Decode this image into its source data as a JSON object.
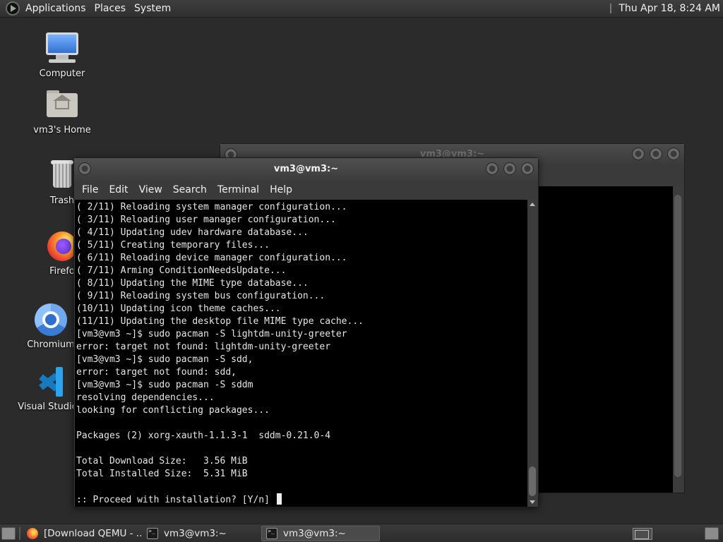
{
  "top_panel": {
    "menus": [
      "Applications",
      "Places",
      "System"
    ],
    "clock": "Thu Apr 18,  8:24 AM"
  },
  "desktop_icons": [
    {
      "label": "Computer",
      "icon": "computer-icon"
    },
    {
      "label": "vm3's Home",
      "icon": "home-folder-icon"
    },
    {
      "label": "Trash",
      "icon": "trash-icon"
    },
    {
      "label": "Firefo",
      "icon": "firefox-icon"
    },
    {
      "label": "Chromium",
      "icon": "chromium-icon"
    },
    {
      "label": "Visual Studio C",
      "icon": "vscode-icon"
    }
  ],
  "back_window": {
    "title": "vm3@vm3:~"
  },
  "terminal": {
    "title": "vm3@vm3:~",
    "menu": [
      "File",
      "Edit",
      "View",
      "Search",
      "Terminal",
      "Help"
    ],
    "lines": [
      "( 2/11) Reloading system manager configuration...",
      "( 3/11) Reloading user manager configuration...",
      "( 4/11) Updating udev hardware database...",
      "( 5/11) Creating temporary files...",
      "( 6/11) Reloading device manager configuration...",
      "( 7/11) Arming ConditionNeedsUpdate...",
      "( 8/11) Updating the MIME type database...",
      "( 9/11) Reloading system bus configuration...",
      "(10/11) Updating icon theme caches...",
      "(11/11) Updating the desktop file MIME type cache...",
      "[vm3@vm3 ~]$ sudo pacman -S lightdm-unity-greeter",
      "error: target not found: lightdm-unity-greeter",
      "[vm3@vm3 ~]$ sudo pacman -S sdd,",
      "error: target not found: sdd,",
      "[vm3@vm3 ~]$ sudo pacman -S sddm",
      "resolving dependencies...",
      "looking for conflicting packages...",
      "",
      "Packages (2) xorg-xauth-1.1.3-1  sddm-0.21.0-4",
      "",
      "Total Download Size:   3.56 MiB",
      "Total Installed Size:  5.31 MiB",
      ""
    ],
    "prompt_line": ":: Proceed with installation? [Y/n] "
  },
  "taskbar": {
    "tasks": [
      {
        "label": "[Download QEMU - ...",
        "icon": "firefox-icon",
        "active": false
      },
      {
        "label": "vm3@vm3:~",
        "icon": "terminal-icon",
        "active": false
      },
      {
        "label": "vm3@vm3:~",
        "icon": "terminal-icon",
        "active": true
      }
    ]
  }
}
